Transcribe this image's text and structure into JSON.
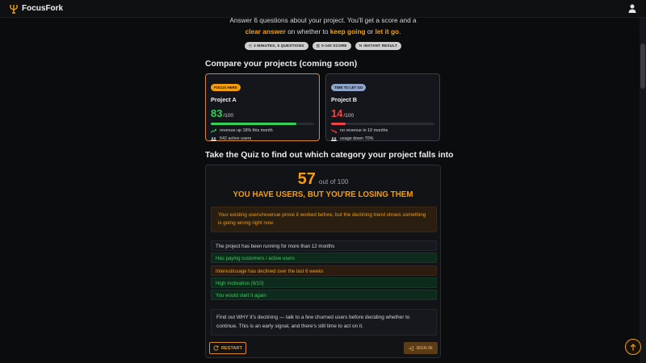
{
  "app": {
    "name": "FocusFork"
  },
  "intro": {
    "line1": "Answer 6 questions about your project. You'll get a score and a",
    "line2_hl1": "clear answer",
    "line2_mid": " on whether to ",
    "line2_hl2": "keep going",
    "line2_or": " or ",
    "line2_hl3": "let it go",
    "line2_end": ".",
    "badges": [
      {
        "icon": "clock-icon",
        "label": "2 MINUTES, 6 QUESTIONS"
      },
      {
        "icon": "chart-icon",
        "label": "0-100 SCORE"
      },
      {
        "icon": "bolt-icon",
        "label": "INSTANT RESULT"
      }
    ]
  },
  "compare": {
    "heading": "Compare your projects (coming soon)",
    "projects": [
      {
        "tag": "FOCUS HERE",
        "name": "Project A",
        "score": "83",
        "out_of": "/100",
        "progress": 0.83,
        "stat1": "revenue up 18% this month",
        "stat2": "542 active users"
      },
      {
        "tag": "TIME TO LET GO",
        "name": "Project B",
        "score": "14",
        "out_of": "/100",
        "progress": 0.14,
        "stat1": "no revenue in 10 months",
        "stat2": "usage down 70%"
      }
    ]
  },
  "quiz": {
    "heading": "Take the Quiz to find out which category your project falls into",
    "score": "57",
    "out_of": "out of 100",
    "verdict": "YOU HAVE USERS, BUT YOU'RE LOSING THEM",
    "warning": "Your existing users/revenue prove it worked before, but the declining trend shows something is going wrong right now.",
    "answers": [
      {
        "text": "The project has been running for more than 12 months",
        "tone": "neutral"
      },
      {
        "text": "Has paying customers / active users",
        "tone": "good"
      },
      {
        "text": "Interest/usage has declined over the last 6 weeks",
        "tone": "bad"
      },
      {
        "text": "High motivation (9/10)",
        "tone": "good"
      },
      {
        "text": "You would start it again",
        "tone": "good"
      }
    ],
    "advice": "Find out WHY it's declining — talk to a few churned users before deciding whether to continue. This is an early signal, and there's still time to act on it.",
    "restart_label": "RESTART",
    "signin_label": "SIGN IN"
  },
  "colors": {
    "accent": "#f59e0b",
    "good": "#34d058",
    "bad": "#ef4444",
    "background": "#0b0c0e"
  }
}
